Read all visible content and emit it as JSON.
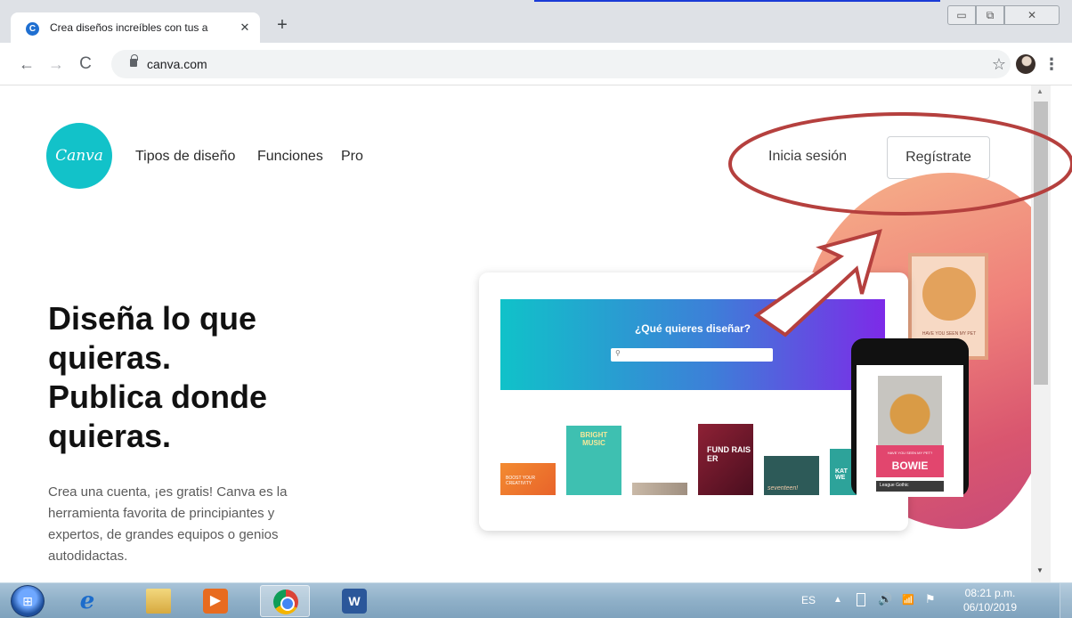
{
  "browser": {
    "tab": {
      "favicon_letter": "C",
      "title": "Crea diseños increíbles con tus a",
      "close_glyph": "✕"
    },
    "new_tab_glyph": "+",
    "window_buttons": {
      "minimize": "▭",
      "maximize": "⧉",
      "close": "✕"
    },
    "nav": {
      "back": "←",
      "forward": "→",
      "reload": "C"
    },
    "url": "canva.com",
    "icons": {
      "bookmark": "☆",
      "menu": "⋮"
    }
  },
  "page": {
    "logo_text": "Canva",
    "nav": [
      "Tipos de diseño",
      "Funciones",
      "Pro"
    ],
    "login_label": "Inicia sesión",
    "signup_label": "Regístrate",
    "hero": {
      "heading_lines": [
        "Diseña lo que",
        "quieras.",
        "Publica donde",
        "quieras."
      ],
      "body": "Crea una cuenta, ¡es gratis! Canva es la herramienta favorita de principiantes y expertos, de grandes equipos o genios autodidactas."
    },
    "mockup": {
      "banner_title": "¿Qué quieres diseñar?",
      "search_icon": "⚲",
      "thumb1": "BOOST YOUR CREATIVITY",
      "thumb2": "BRIGHT MUSIC",
      "thumb4": "FUND RAIS ER",
      "thumb5": "seventeen!",
      "thumb6": "KAT WE",
      "dog_poster_caption": "HAVE YOU SEEN MY PET",
      "phone_tag": "HAVE YOU SEEN MY PET?",
      "phone_title": "BOWIE",
      "phone_bar": "League Gothic"
    }
  },
  "annotations": {
    "color": "#b5403e",
    "highlight": "auth-area",
    "arrow": "pointing-to-signup"
  },
  "taskbar": {
    "start_glyph": "⊞",
    "apps": [
      {
        "name": "internet-explorer",
        "glyph": "e"
      },
      {
        "name": "file-explorer",
        "glyph": ""
      },
      {
        "name": "media-player",
        "glyph": "▶"
      },
      {
        "name": "chrome",
        "glyph": ""
      },
      {
        "name": "word",
        "glyph": "W"
      }
    ],
    "active_app": "chrome",
    "language": "ES",
    "tray": {
      "arrow": "▲",
      "volume": "🔊",
      "signal": "📶",
      "flag": "⚑"
    },
    "clock_time": "08:21 p.m.",
    "clock_date": "06/10/2019"
  },
  "colors": {
    "canva_teal": "#12c2c9",
    "banner_gradient": [
      "#10c2c9",
      "#7d2ae8"
    ],
    "annotation_red": "#b5403e"
  }
}
